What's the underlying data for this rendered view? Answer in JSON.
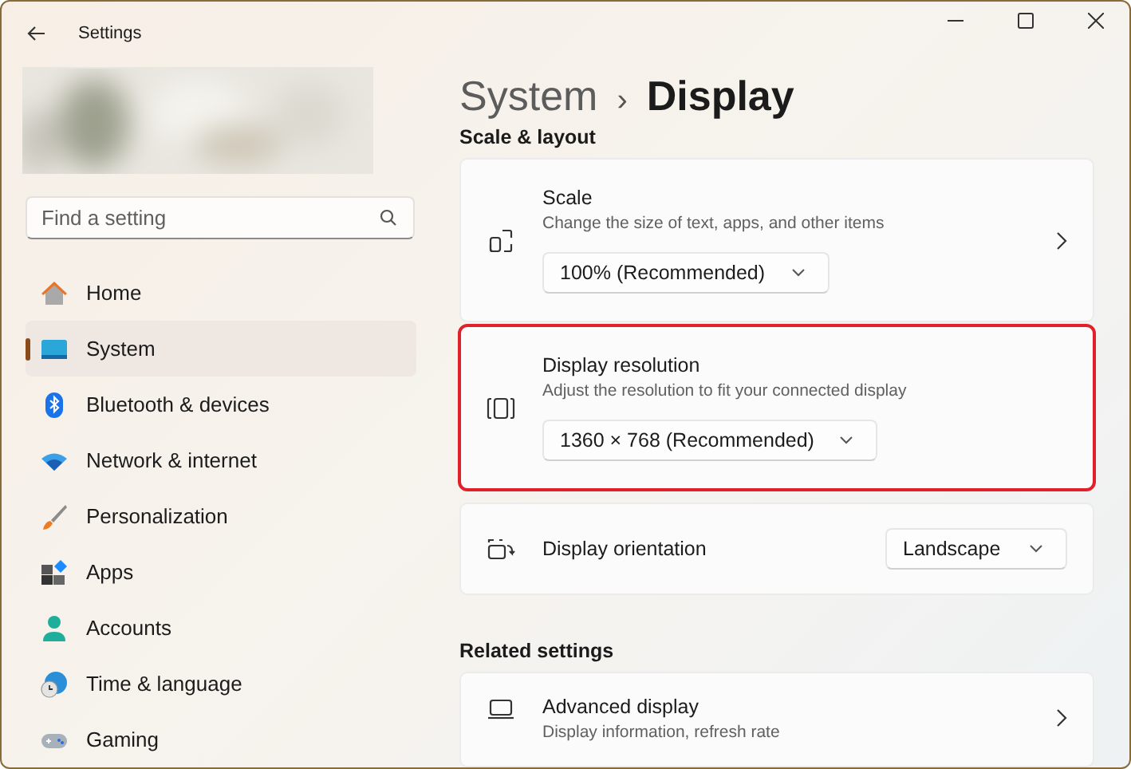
{
  "window": {
    "title": "Settings"
  },
  "search": {
    "placeholder": "Find a setting"
  },
  "nav": [
    {
      "label": "Home",
      "selected": false
    },
    {
      "label": "System",
      "selected": true
    },
    {
      "label": "Bluetooth & devices",
      "selected": false
    },
    {
      "label": "Network & internet",
      "selected": false
    },
    {
      "label": "Personalization",
      "selected": false
    },
    {
      "label": "Apps",
      "selected": false
    },
    {
      "label": "Accounts",
      "selected": false
    },
    {
      "label": "Time & language",
      "selected": false
    },
    {
      "label": "Gaming",
      "selected": false
    }
  ],
  "breadcrumb": {
    "parent": "System",
    "separator": "›",
    "current": "Display"
  },
  "sections": [
    {
      "heading": "Scale & layout",
      "rows": [
        {
          "kind": "stacked",
          "title": "Scale",
          "subtitle": "Change the size of text, apps, and other items",
          "dropdown": "100% (Recommended)",
          "chevron": true,
          "highlighted": false
        },
        {
          "kind": "stacked",
          "title": "Display resolution",
          "subtitle": "Adjust the resolution to fit your connected display",
          "dropdown": "1360 × 768 (Recommended)",
          "chevron": false,
          "highlighted": true
        },
        {
          "kind": "inline",
          "title": "Display orientation",
          "dropdown": "Landscape",
          "chevron": false,
          "highlighted": false
        }
      ]
    },
    {
      "heading": "Related settings",
      "rows": [
        {
          "kind": "link",
          "title": "Advanced display",
          "subtitle": "Display information, refresh rate",
          "chevron": true,
          "highlighted": false
        }
      ]
    }
  ]
}
